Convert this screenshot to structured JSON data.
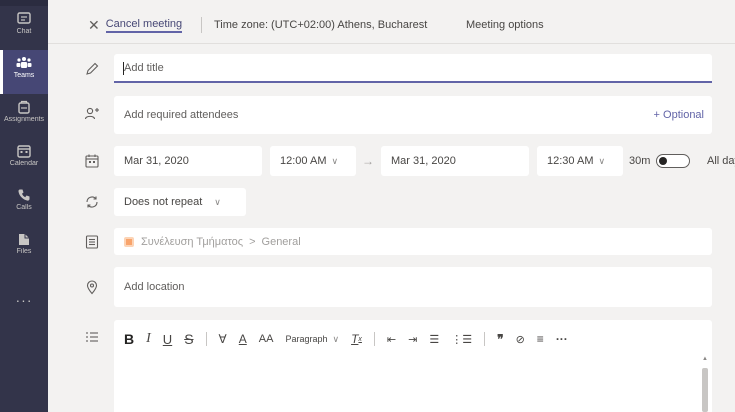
{
  "rail": {
    "items": [
      {
        "label": "Chat",
        "icon": "chat-icon"
      },
      {
        "label": "Teams",
        "icon": "teams-icon",
        "active": true
      },
      {
        "label": "Assignments",
        "icon": "assignments-icon"
      },
      {
        "label": "Calendar",
        "icon": "calendar-icon"
      },
      {
        "label": "Calls",
        "icon": "calls-icon"
      },
      {
        "label": "Files",
        "icon": "files-icon"
      }
    ],
    "more": "···"
  },
  "toolbar": {
    "cancel_label": "Cancel meeting",
    "timezone": "Time zone: (UTC+02:00) Athens, Bucharest",
    "options_label": "Meeting options"
  },
  "form": {
    "title_placeholder": "Add title",
    "attendees_placeholder": "Add required attendees",
    "optional_label": "+ Optional",
    "start_date": "Mar 31, 2020",
    "start_time": "12:00 AM",
    "end_date": "Mar 31, 2020",
    "end_time": "12:30 AM",
    "arrow": "→",
    "duration": "30m",
    "allday_label": "All day",
    "allday_on": false,
    "repeat": "Does not repeat",
    "channel_name": "Συνέλευση Τμήματος",
    "channel_sep": ">",
    "channel_sub": "General",
    "location_placeholder": "Add location"
  },
  "editor": {
    "bold": "B",
    "italic": "I",
    "underline": "U",
    "strike": "S",
    "highlight": "∀",
    "font_color": "A",
    "font_size": "AA",
    "paragraph": "Paragraph",
    "clear_format": "T",
    "decrease_indent": "⇤",
    "increase_indent": "⇥",
    "bullets": "☰",
    "numbering": "⋮☰",
    "quote": "❞",
    "link": "⊘",
    "align": "≡",
    "more": "···"
  },
  "colors": {
    "rail": "#33344a",
    "accent": "#6264a7",
    "channel_icon": "#f8a46c"
  }
}
